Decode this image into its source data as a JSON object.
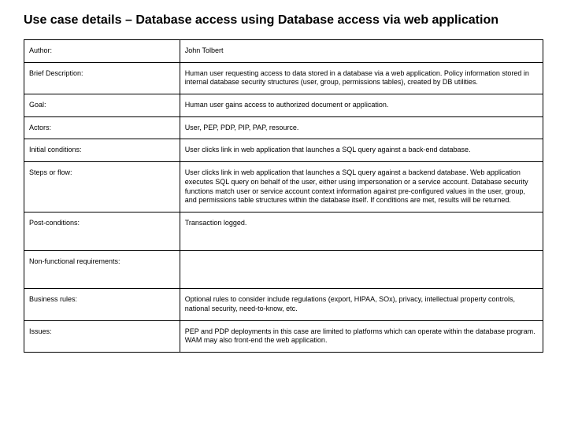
{
  "title": "Use case details – Database access using Database access via web application",
  "rows": [
    {
      "label": "Author:",
      "value": "John Tolbert"
    },
    {
      "label": "Brief Description:",
      "value": "Human user requesting access to data stored in a database via a web application. Policy information stored in internal database security structures (user, group, permissions tables), created by DB utilities."
    },
    {
      "label": "Goal:",
      "value": "Human user gains access to authorized document or application."
    },
    {
      "label": "Actors:",
      "value": "User, PEP, PDP, PIP, PAP, resource."
    },
    {
      "label": "Initial conditions:",
      "value": "User clicks link in web application that launches a SQL query against a back-end database."
    },
    {
      "label": "Steps or flow:",
      "value": "User clicks link in web application that launches a SQL query against a backend database. Web application executes SQL query on behalf of the user, either using impersonation or a service account. Database security functions match user or service account context information against pre-configured values in the user, group, and permissions table structures within the database itself. If conditions are met, results will be returned."
    },
    {
      "label": "Post-conditions:",
      "value": "Transaction logged."
    },
    {
      "label": "Non-functional requirements:",
      "value": ""
    },
    {
      "label": "Business rules:",
      "value": "Optional rules to consider include regulations (export, HIPAA, SOx), privacy, intellectual property controls, national security, need-to-know, etc."
    },
    {
      "label": "Issues:",
      "value": "PEP and PDP deployments in this case are limited to platforms which can operate within the database program. WAM may also front-end the web application."
    }
  ],
  "tall_rows": [
    6,
    7
  ]
}
